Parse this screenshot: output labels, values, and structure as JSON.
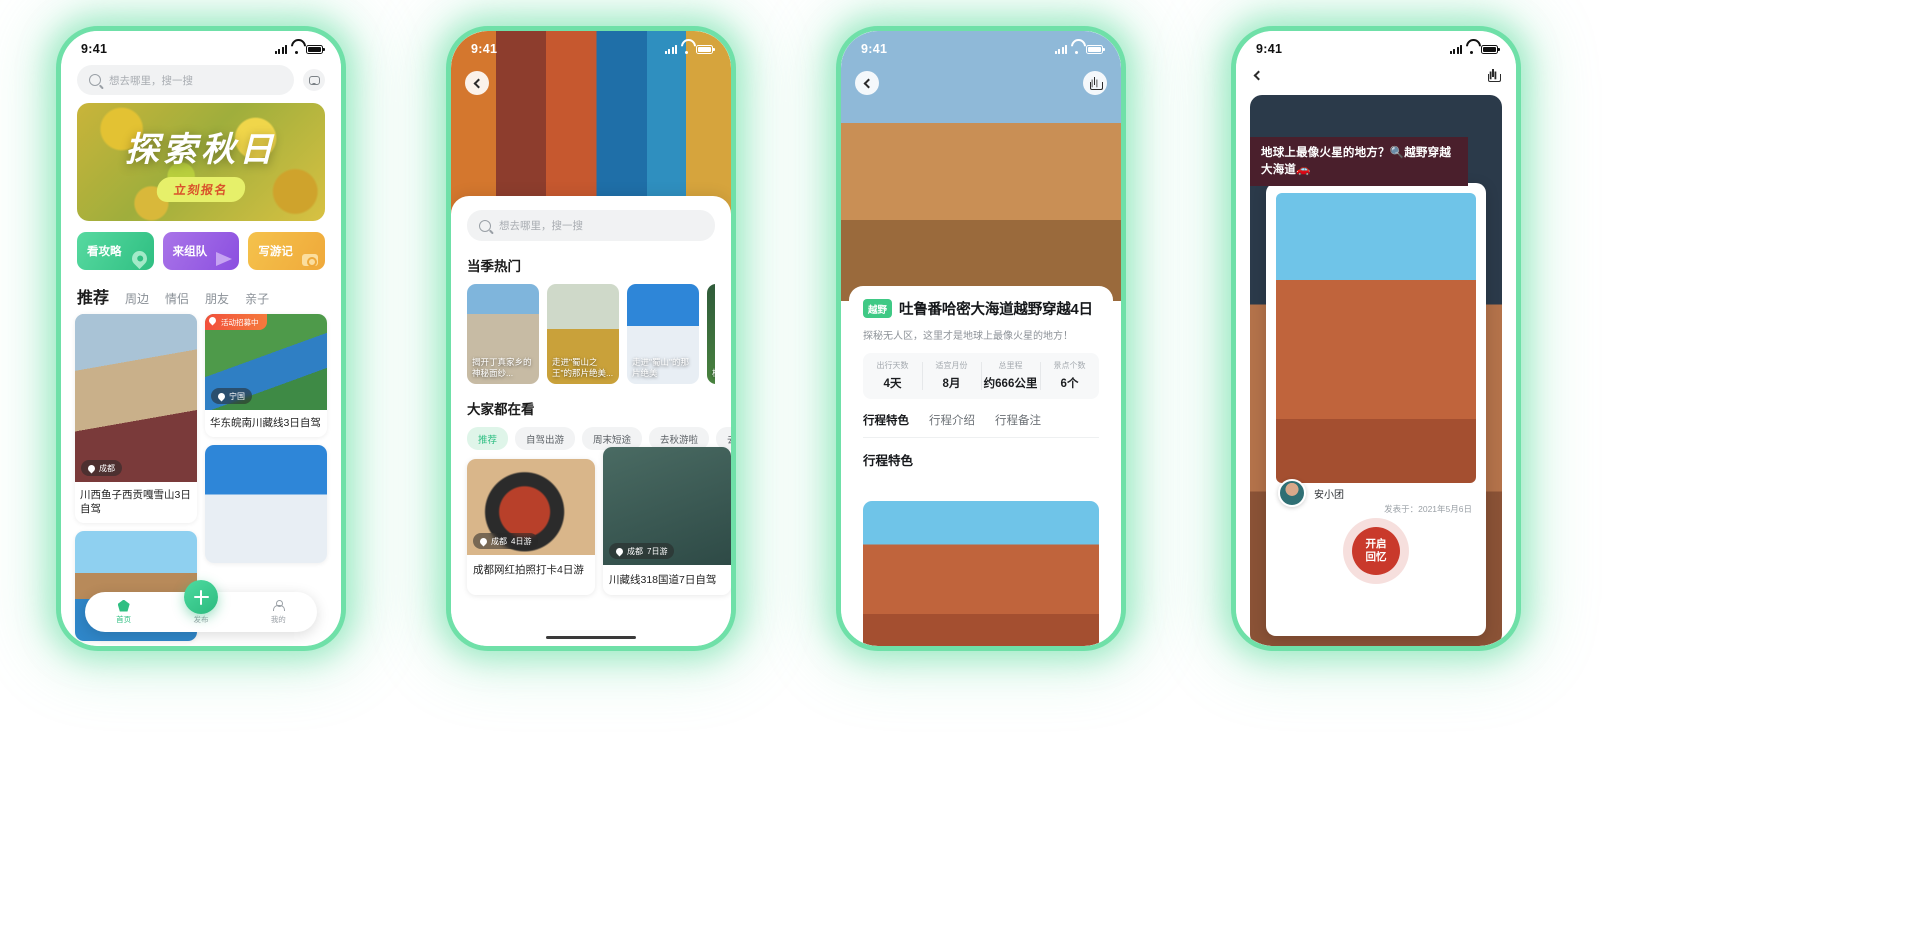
{
  "statusbar": {
    "time": "9:41"
  },
  "phone1": {
    "search": {
      "placeholder": "想去哪里，搜一搜",
      "icon": "search-icon"
    },
    "chat_icon": "chat-bubble-icon",
    "banner": {
      "title": "探索秋日",
      "cta": "立刻报名"
    },
    "quick_actions": [
      {
        "label": "看攻略",
        "color": "#2fbf82",
        "icon": "map-pin-icon"
      },
      {
        "label": "来组队",
        "color": "#8b4fe0",
        "icon": "paper-plane-icon"
      },
      {
        "label": "写游记",
        "color": "#efa93a",
        "icon": "camera-icon"
      }
    ],
    "tabs": [
      {
        "label": "推荐",
        "active": true
      },
      {
        "label": "周边",
        "active": false
      },
      {
        "label": "情侣",
        "active": false
      },
      {
        "label": "朋友",
        "active": false
      },
      {
        "label": "亲子",
        "active": false
      }
    ],
    "cards": [
      {
        "title": "川西鱼子西贡嘎雪山3日自驾",
        "location": "成都",
        "badge": ""
      },
      {
        "title": "华东皖南川藏线3日自驾",
        "location": "宁国",
        "badge": "活动招募中"
      }
    ],
    "tabbar": [
      {
        "label": "首页",
        "icon": "home-icon",
        "active": true
      },
      {
        "label": "发布",
        "icon": "plus-icon",
        "active": false
      },
      {
        "label": "我的",
        "icon": "person-icon",
        "active": false
      }
    ]
  },
  "phone2": {
    "back_icon": "chevron-left-icon",
    "search": {
      "placeholder": "想去哪里，搜一搜",
      "icon": "search-icon"
    },
    "section_hot": "当季热门",
    "hot_items": [
      {
        "caption": "揭开丁真家乡的神秘面纱..."
      },
      {
        "caption": "走进\"蜀山之王\"的那片绝美..."
      },
      {
        "caption": "走进\"蜀山\"的那片绝美"
      },
      {
        "caption": "桂林"
      }
    ],
    "section_all": "大家都在看",
    "chips": [
      {
        "label": "推荐",
        "active": true
      },
      {
        "label": "自驾出游",
        "active": false
      },
      {
        "label": "周末短途",
        "active": false
      },
      {
        "label": "去秋游啦",
        "active": false
      },
      {
        "label": "去",
        "active": false
      }
    ],
    "cards": [
      {
        "title": "成都网红拍照打卡4日游",
        "location": "成都",
        "days": "4日游"
      },
      {
        "title": "川藏线318国道7日自驾",
        "location": "成都",
        "days": "7日游"
      }
    ]
  },
  "phone3": {
    "back_icon": "chevron-left-icon",
    "share_icon": "share-icon",
    "tag": "越野",
    "title": "吐鲁番哈密大海道越野穿越4日",
    "subtitle": "探秘无人区，这里才是地球上最像火星的地方！",
    "stats": [
      {
        "key": "出行天数",
        "value": "4天"
      },
      {
        "key": "适宜月份",
        "value": "8月"
      },
      {
        "key": "总里程",
        "value": "约666公里"
      },
      {
        "key": "景点个数",
        "value": "6个"
      }
    ],
    "tabs": [
      {
        "label": "行程特色",
        "active": true
      },
      {
        "label": "行程介绍",
        "active": false
      },
      {
        "label": "行程备注",
        "active": false
      }
    ],
    "section": "行程特色"
  },
  "phone4": {
    "back_icon": "chevron-left-icon",
    "share_icon": "share-icon",
    "title": "地球上最像火星的地方？🔍越野穿越大海道🚗",
    "author": "安小团",
    "date": "发表于：2021年5月6日",
    "fab": {
      "line1": "开启",
      "line2": "回忆",
      "color": "#c9392b"
    }
  }
}
